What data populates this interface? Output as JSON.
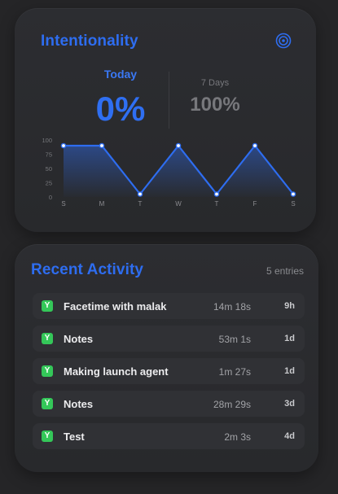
{
  "intentionality": {
    "title": "Intentionality",
    "icon": "target-icon",
    "accent_color": "#2e6df0",
    "today_label": "Today",
    "today_value": "0%",
    "week_label": "7 Days",
    "week_value": "100%"
  },
  "chart_data": {
    "type": "area",
    "categories": [
      "S",
      "M",
      "T",
      "W",
      "T",
      "F",
      "S"
    ],
    "values": [
      90,
      90,
      5,
      90,
      5,
      90,
      5
    ],
    "yticks": [
      "100",
      "75",
      "50",
      "25",
      "0"
    ],
    "ylim": [
      0,
      100
    ],
    "grid": false,
    "line_color": "#2e6df0"
  },
  "recent": {
    "title": "Recent Activity",
    "entries_label": "5 entries",
    "items": [
      {
        "badge": "Y",
        "name": "Facetime with malak",
        "duration": "14m 18s",
        "ago": "9h"
      },
      {
        "badge": "Y",
        "name": "Notes",
        "duration": "53m 1s",
        "ago": "1d"
      },
      {
        "badge": "Y",
        "name": "Making launch agent",
        "duration": "1m 27s",
        "ago": "1d"
      },
      {
        "badge": "Y",
        "name": "Notes",
        "duration": "28m 29s",
        "ago": "3d"
      },
      {
        "badge": "Y",
        "name": "Test",
        "duration": "2m 3s",
        "ago": "4d"
      }
    ],
    "badge_color": "#34c759"
  }
}
